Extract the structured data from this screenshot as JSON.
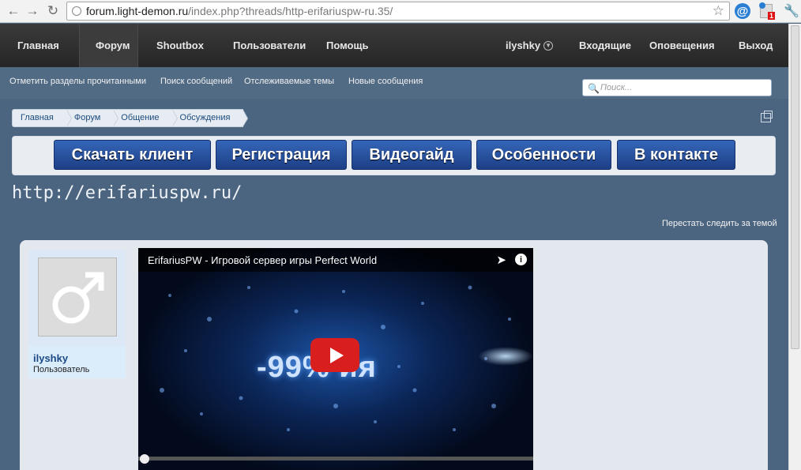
{
  "browser": {
    "url_host": "forum.light-demon.ru",
    "url_path": "/index.php?threads/http-erifariuspw-ru.35/",
    "pdf_badge": "1",
    "ext_at": "@"
  },
  "nav": {
    "items": [
      "Главная",
      "Форум",
      "Shoutbox",
      "Пользователи",
      "Помощь"
    ],
    "active_index": 1,
    "username": "ilyshky",
    "inbox": "Входящие",
    "alerts": "Оповещения",
    "logout": "Выход"
  },
  "subnav": {
    "links": [
      "Отметить разделы прочитанными",
      "Поиск сообщений",
      "Отслеживаемые темы",
      "Новые сообщения"
    ],
    "search_placeholder": "Поиск..."
  },
  "breadcrumb": [
    "Главная",
    "Форум",
    "Общение",
    "Обсуждения"
  ],
  "banner_buttons": [
    "Скачать клиент",
    "Регистрация",
    "Видеогайд",
    "Особенности",
    "В контакте"
  ],
  "thread": {
    "title": "http://erifariuspw.ru/",
    "unwatch": "Перестать следить за темой"
  },
  "post": {
    "author": "ilyshky",
    "role": "Пользователь",
    "video_title": "ErifariusPW - Игровой сервер игры Perfect World",
    "video_overlay_text": "-99% ия"
  },
  "colors": {
    "nav_bg": "#2c2c2c",
    "page_bg": "#4b6580",
    "button_blue": "#2a55a4",
    "play_red": "#d91e1e"
  }
}
